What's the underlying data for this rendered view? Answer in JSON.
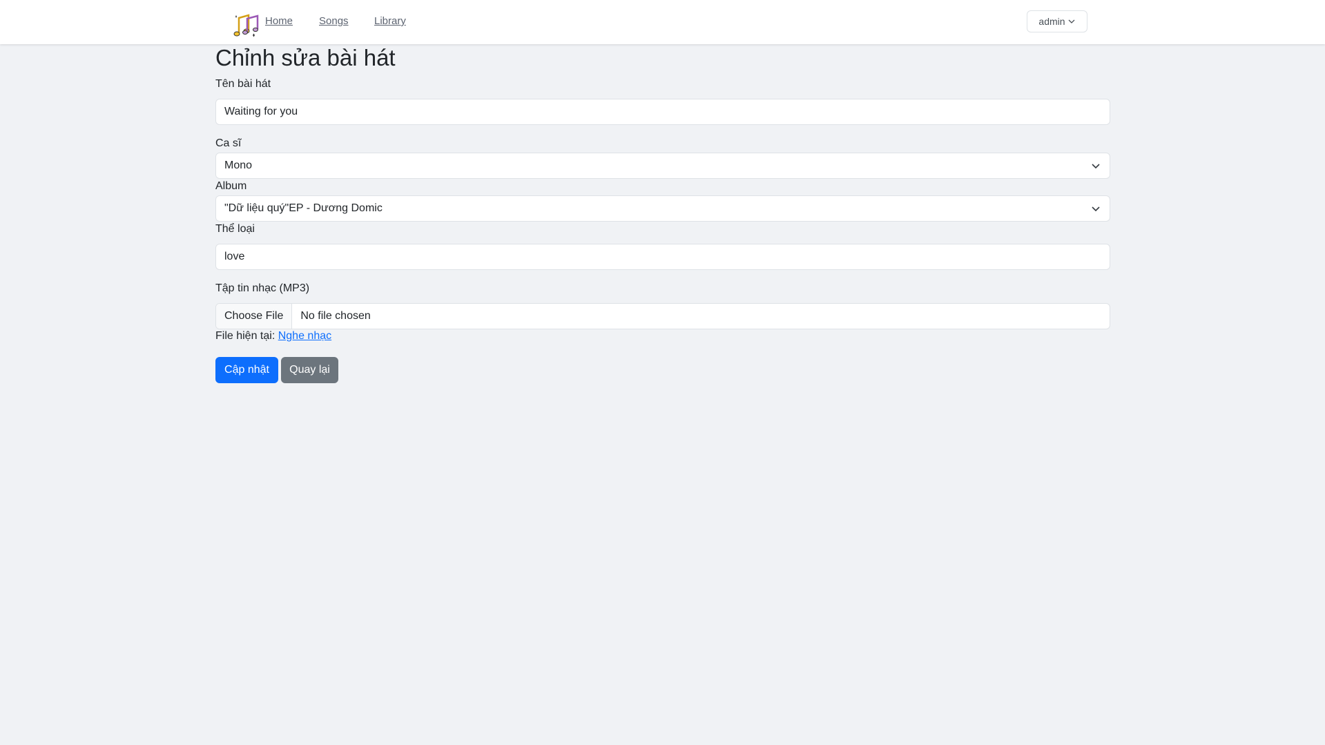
{
  "nav": {
    "links": [
      "Home",
      "Songs",
      "Library"
    ],
    "user": "admin"
  },
  "form": {
    "title": "Chỉnh sửa bài hát",
    "song_name_label": "Tên bài hát",
    "song_name_value": "Waiting for you",
    "artist_label": "Ca sĩ",
    "artist_value": "Mono",
    "album_label": "Album",
    "album_value": "\"Dữ liệu quý\"EP - Dương Domic",
    "genre_label": "Thể loại",
    "genre_value": "love",
    "file_label": "Tập tin nhạc (MP3)",
    "file_button": "Choose File",
    "file_status": "No file chosen",
    "current_file_label": "File hiện tại:",
    "current_file_link": "Nghe nhạc",
    "submit_label": "Cập nhật",
    "back_label": "Quay lại"
  },
  "colors": {
    "primary": "#0d6efd",
    "secondary": "#6c757d",
    "background": "#f0f2f5"
  },
  "icons": [
    "music-notes-logo-icon",
    "chevron-down-icon"
  ]
}
